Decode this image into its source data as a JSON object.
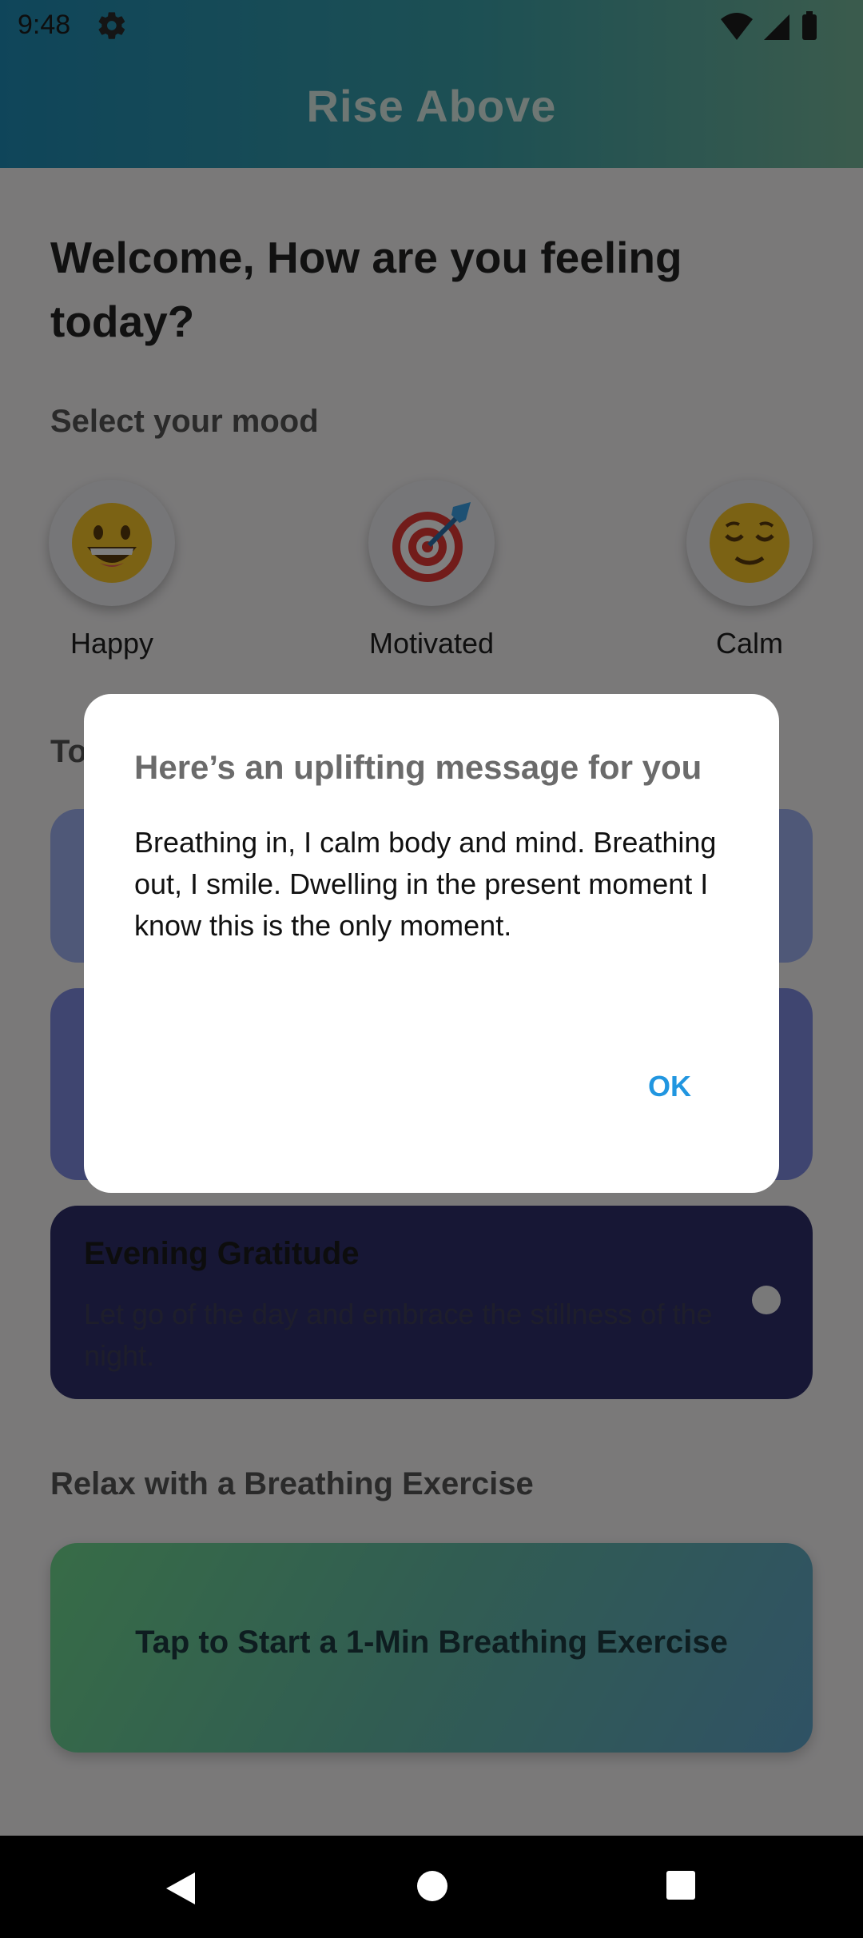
{
  "status_bar": {
    "time": "9:48",
    "icons": [
      "gear-icon",
      "wifi-icon",
      "signal-icon",
      "battery-icon"
    ]
  },
  "app_bar": {
    "title": "Rise Above"
  },
  "main": {
    "welcome": "Welcome, How are you feeling today?",
    "mood_section_label": "Select your mood",
    "moods": [
      {
        "label": "Happy",
        "icon": "grinning-face-icon"
      },
      {
        "label": "Motivated",
        "icon": "target-dart-icon"
      },
      {
        "label": "Calm",
        "icon": "relieved-face-icon"
      }
    ],
    "todays_section_label": "To",
    "cards": [
      {
        "title": "",
        "description": "",
        "color": "#9fb1f0"
      },
      {
        "title": "",
        "description": "",
        "color": "#7f8be0"
      },
      {
        "title": "Evening Gratitude",
        "description": "Let go of the day and embrace the stillness of the night.",
        "color": "#2e2f6b"
      }
    ],
    "breathing_section_label": "Relax with a Breathing Exercise",
    "breathing_button": "Tap to Start a 1-Min Breathing Exercise"
  },
  "dialog": {
    "title": "Here’s an uplifting message for you",
    "message": "Breathing in, I calm body and mind. Breathing out, I smile. Dwelling in the present moment I know this is the only moment.",
    "ok_label": "OK"
  },
  "nav_bar": {
    "buttons": [
      "back-icon",
      "home-icon",
      "recents-icon"
    ]
  },
  "colors": {
    "accent": "#2196e0",
    "app_bar_start": "#1f8bb4",
    "app_bar_end": "#76b79a"
  }
}
